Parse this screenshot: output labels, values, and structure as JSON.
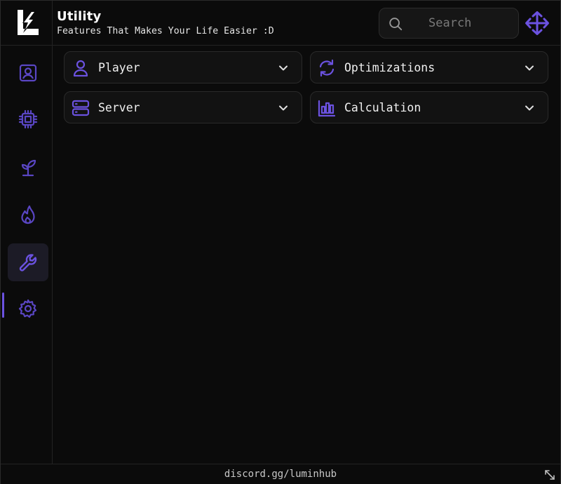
{
  "header": {
    "title": "Utility",
    "subtitle": "Features That Makes Your Life Easier :D",
    "logo_icon": "lumin-logo-icon",
    "move_icon": "move-arrows-icon"
  },
  "search": {
    "placeholder": "Search",
    "icon": "search-icon"
  },
  "sidebar": {
    "items": [
      {
        "icon": "user-square-icon",
        "active": false
      },
      {
        "icon": "chip-icon",
        "active": false
      },
      {
        "icon": "sprout-icon",
        "active": false
      },
      {
        "icon": "flame-icon",
        "active": false
      },
      {
        "icon": "wrench-icon",
        "active": true
      },
      {
        "icon": "gear-icon",
        "active": false
      }
    ]
  },
  "sections": [
    {
      "label": "Player",
      "icon": "user-icon"
    },
    {
      "label": "Optimizations",
      "icon": "refresh-icon"
    },
    {
      "label": "Server",
      "icon": "server-icon"
    },
    {
      "label": "Calculation",
      "icon": "bar-chart-icon"
    }
  ],
  "footer": {
    "text": "discord.gg/luminhub",
    "resize_icon": "resize-icon"
  },
  "colors": {
    "accent": "#6b52e0",
    "background": "#0b0b0b",
    "card": "#121212",
    "border": "#2a2a2a"
  }
}
